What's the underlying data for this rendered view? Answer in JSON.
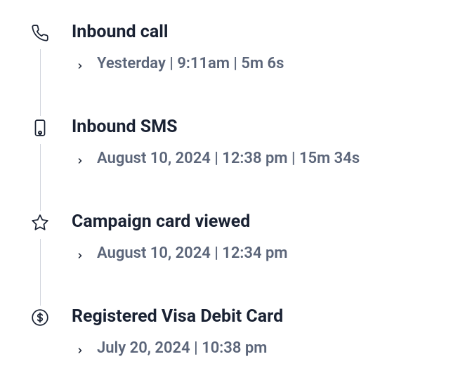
{
  "timeline": {
    "items": [
      {
        "icon": "phone-icon",
        "title": "Inbound call",
        "meta": "Yesterday | 9:11am | 5m 6s"
      },
      {
        "icon": "sms-icon",
        "title": "Inbound SMS",
        "meta": "August 10, 2024 | 12:38 pm | 15m 34s"
      },
      {
        "icon": "star-icon",
        "title": "Campaign card viewed",
        "meta": "August 10, 2024 | 12:34 pm"
      },
      {
        "icon": "dollar-icon",
        "title": "Registered Visa Debit Card",
        "meta": "July 20, 2024 | 10:38 pm"
      }
    ]
  }
}
